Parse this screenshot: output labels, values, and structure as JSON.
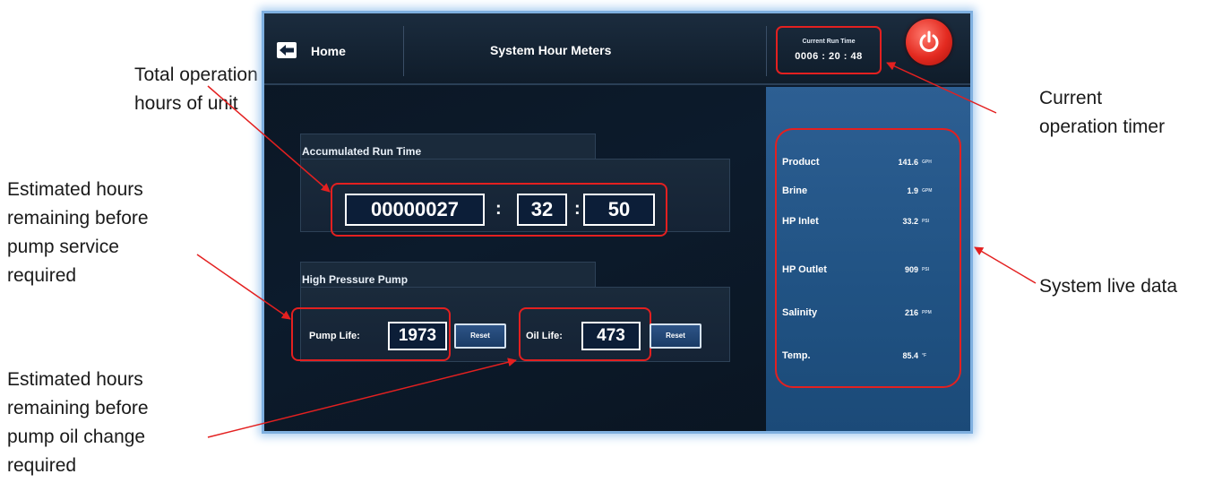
{
  "screen": {
    "home_label": "Home",
    "title": "System Hour Meters",
    "current_run_time": {
      "caption": "Current Run Time",
      "value": "0006 : 20 : 48"
    }
  },
  "accumulated": {
    "heading": "Accumulated Run Time",
    "hours": "00000027",
    "minutes": "32",
    "seconds": "50",
    "separator": ":"
  },
  "pump": {
    "heading": "High Pressure Pump",
    "pump_life_label": "Pump Life:",
    "pump_life_value": "1973",
    "oil_life_label": "Oil Life:",
    "oil_life_value": "473",
    "reset_label": "Reset"
  },
  "live_data": [
    {
      "label": "Product",
      "value": "141.6",
      "unit": "GPH"
    },
    {
      "label": "Brine",
      "value": "1.9",
      "unit": "GPM"
    },
    {
      "label": "HP Inlet",
      "value": "33.2",
      "unit": "PSI"
    },
    {
      "label": "HP Outlet",
      "value": "909",
      "unit": "PSI"
    },
    {
      "label": "Salinity",
      "value": "216",
      "unit": "PPM"
    },
    {
      "label": "Temp.",
      "value": "85.4",
      "unit": "°F"
    }
  ],
  "annotations": {
    "total_hours": [
      "Total operation",
      "hours of unit"
    ],
    "pump_service": [
      "Estimated hours",
      "remaining before",
      "pump service",
      "required"
    ],
    "oil_change": [
      "Estimated hours",
      "remaining before",
      "pump oil change",
      "required"
    ],
    "current_timer": [
      "Current",
      "operation timer"
    ],
    "live_data": [
      "System live data"
    ]
  },
  "colors": {
    "highlight": "#e32020",
    "panel_blue": "#215384",
    "screen_bg": "#0c1b2c",
    "power_red": "#e32a20"
  },
  "icons": {
    "back": "back-arrow-icon",
    "power": "power-icon"
  }
}
